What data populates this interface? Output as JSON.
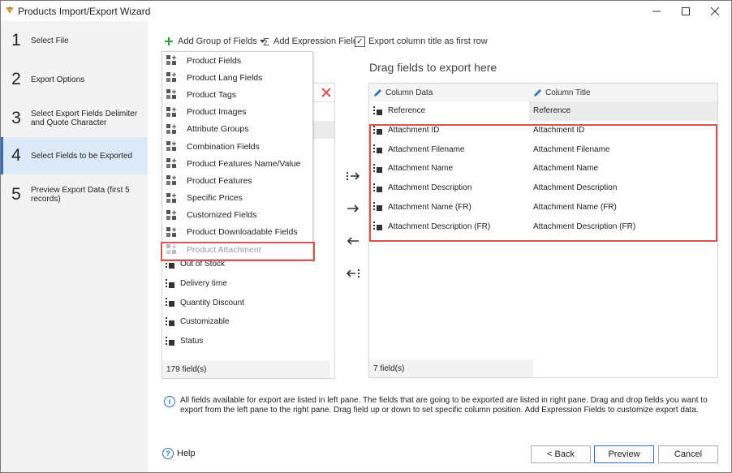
{
  "window": {
    "title": "Products Import/Export Wizard"
  },
  "steps": [
    {
      "num": "1",
      "label": "Select File"
    },
    {
      "num": "2",
      "label": "Export Options"
    },
    {
      "num": "3",
      "label": "Select Export Fields Delimiter and Quote Character"
    },
    {
      "num": "4",
      "label": "Select Fields to be Exported"
    },
    {
      "num": "5",
      "label": "Preview Export Data (first 5 records)"
    }
  ],
  "toolbar": {
    "add_group_label": "Add Group of Fields",
    "add_expression_label": "Add Expression Field",
    "export_title_label": "Export column title as first row"
  },
  "group_menu": [
    "Product Fields",
    "Product Lang Fields",
    "Product Tags",
    "Product Images",
    "Attribute Groups",
    "Combination Fields",
    "Product Features Name/Value",
    "Product Features",
    "Specific Prices",
    "Customized Fields",
    "Product Downloadable Fields",
    "Product Attachment"
  ],
  "left_pane": {
    "visible_fields": [
      "Out of Stock",
      "Delivery time",
      "Quantity Discount",
      "Customizable",
      "Status"
    ],
    "count_label": "179 field(s)"
  },
  "right_pane": {
    "title": "Drag fields to export here",
    "col_data": "Column Data",
    "col_title": "Column Title",
    "rows": [
      {
        "data": "Reference",
        "title": "Reference"
      },
      {
        "data": "Attachment ID",
        "title": "Attachment ID"
      },
      {
        "data": "Attachment Filename",
        "title": "Attachment Filename"
      },
      {
        "data": "Attachment Name",
        "title": "Attachment Name"
      },
      {
        "data": "Attachment Description",
        "title": "Attachment Description"
      },
      {
        "data": "Attachment Name (FR)",
        "title": "Attachment Name (FR)"
      },
      {
        "data": "Attachment Description (FR)",
        "title": "Attachment Description (FR)"
      }
    ],
    "count_label": "7 field(s)"
  },
  "info_text": "All fields available for export are listed in left pane. The fields that are going to be exported are listed in right pane. Drag and drop fields you want to export from the left pane to the right pane. Drag field up or down to set specific column position. Add Expression Fields to customize export data.",
  "footer": {
    "help_label": "Help",
    "back_label": "< Back",
    "preview_label": "Preview",
    "cancel_label": "Cancel"
  },
  "colors": {
    "accent": "#2f70c0",
    "highlight": "#d9534f",
    "sidebar_bg": "#f3f3f3",
    "active_step_bg": "#dbe9f8"
  }
}
